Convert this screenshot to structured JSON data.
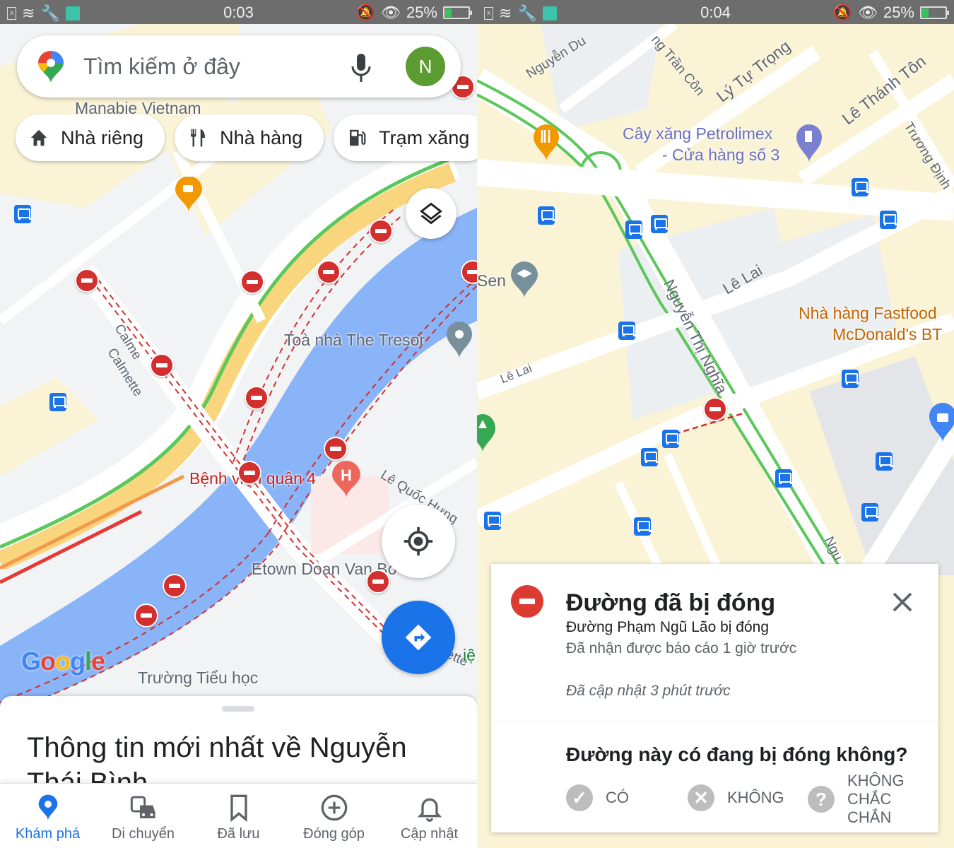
{
  "left_phone": {
    "status": {
      "time": "0:03",
      "battery": "25%"
    },
    "search": {
      "placeholder": "Tìm kiếm ở đây",
      "avatar_initial": "N"
    },
    "chips": [
      {
        "label": "Nhà riêng",
        "icon": "home-icon"
      },
      {
        "label": "Nhà hàng",
        "icon": "restaurant-icon"
      },
      {
        "label": "Trạm xăng",
        "icon": "gas-station-icon"
      }
    ],
    "map_labels": {
      "manabie": "Manabie Vietnam",
      "tresor": "Toà nhà The Tresor",
      "hospital": "Bệnh viện quận 4",
      "etown": "Etown Doan Van Bo",
      "school": "Trường Tiểu học",
      "road_calme": "Calme",
      "road_calmette": "Calmette",
      "road_le_quoc_hung": "Lê Quốc Hưng",
      "road_ette": "ette",
      "partial_ie": "iệ",
      "google": "Google"
    },
    "sheet": {
      "title": "Thông tin mới nhất về Nguyễn Thái Bình"
    },
    "bottom_nav": [
      {
        "label": "Khám phá",
        "active": true
      },
      {
        "label": "Di chuyển",
        "active": false
      },
      {
        "label": "Đã lưu",
        "active": false
      },
      {
        "label": "Đóng góp",
        "active": false
      },
      {
        "label": "Cập nhật",
        "active": false
      }
    ]
  },
  "right_phone": {
    "status": {
      "time": "0:04",
      "battery": "25%"
    },
    "map_labels": {
      "nguyen_du": "Nguyễn Du",
      "tran_con": "ng Trần Côn",
      "ly_tu_trong": "Lý Tự Trọng",
      "le_thanh_ton": "Lê Thánh Tôn",
      "truong_dinh": "Trương Định",
      "petrolimex_1": "Cây xăng Petrolimex",
      "petrolimex_2": "- Cửa hàng số 3",
      "sen": "Sen",
      "le_lai_1": "Lê Lai",
      "le_lai_2": "Lê Lai",
      "nguyen_thi_nghia": "Nguyễn Thị Nghĩa",
      "mcdonalds_1": "Nhà hàng Fastfood",
      "mcdonalds_2": "McDonald's BT",
      "ngu": "Ngu"
    },
    "card": {
      "title": "Đường đã bị đóng",
      "subtitle": "Đường Phạm Ngũ Lão bị đóng",
      "reported": "Đã nhận được báo cáo 1 giờ trước",
      "updated": "Đã cập nhật 3 phút trước",
      "question": "Đường này có đang bị đóng không?",
      "answers": [
        {
          "label": "CÓ",
          "icon": "check-icon",
          "glyph": "✓"
        },
        {
          "label": "KHÔNG",
          "icon": "x-icon",
          "glyph": "✕"
        },
        {
          "label": "KHÔNG CHẮC CHẮN",
          "icon": "question-icon",
          "glyph": "?"
        }
      ]
    }
  },
  "colors": {
    "accent": "#1a73e8",
    "closure_red": "#d32f2f",
    "traffic_green": "#5ac85a",
    "water": "#8ab4f8",
    "map_bg": "#f1f3f4",
    "block_yellow": "#fbf3d5",
    "avatar_green": "#5b9b32"
  }
}
